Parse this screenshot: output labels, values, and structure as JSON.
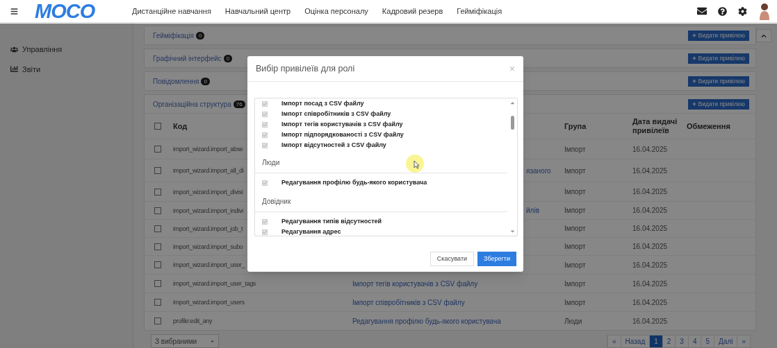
{
  "header": {
    "logo": "MOCO",
    "nav": [
      {
        "label": "Дистанційне навчання"
      },
      {
        "label": "Навчальний центр"
      },
      {
        "label": "Оцінка персоналу"
      },
      {
        "label": "Кадровий резерв"
      },
      {
        "label": "Гейміфікація"
      }
    ]
  },
  "sidebar": {
    "items": [
      {
        "label": "Управління",
        "kind": "users"
      },
      {
        "label": "Звіти",
        "kind": "chart"
      }
    ]
  },
  "sections": [
    {
      "title": "Гейміфікація",
      "count": "0",
      "button": "Видати привілею"
    },
    {
      "title": "Графічний інтерфейс",
      "count": "0",
      "button": "Видати привілею"
    },
    {
      "title": "Повідомлення",
      "count": "0",
      "button": "Видати привілею"
    },
    {
      "title": "Організаційна структура",
      "count": "76",
      "button": "Видати привілею"
    }
  ],
  "table": {
    "select_all": {
      "checked": false
    },
    "columns": [
      {
        "label": "Код"
      },
      {
        "label": "Група"
      },
      {
        "label": "Дата видачі привілеїв"
      },
      {
        "label": "Обмеження"
      }
    ],
    "rows": [
      {
        "checked": false,
        "code": "import_wizard.import_abse",
        "group": "Імпорт",
        "date": "16.04.2025"
      },
      {
        "checked": false,
        "code": "import_wizard.import_all_di",
        "description": "язаного",
        "partial": true,
        "group": "Імпорт",
        "date": "16.04.2025"
      },
      {
        "checked": false,
        "code": "import_wizard.import_divisi",
        "group": "Імпорт",
        "date": "16.04.2025"
      },
      {
        "checked": false,
        "code": "import_wizard.import_indivi",
        "description": "йлів",
        "partial": true,
        "group": "Імпорт",
        "date": "16.04.2025"
      },
      {
        "checked": false,
        "code": "import_wizard.import_job_t",
        "group": "Імпорт",
        "date": "16.04.2025"
      },
      {
        "checked": false,
        "code": "import_wizard.import_subo",
        "group": "Імпорт",
        "date": "16.04.2025"
      },
      {
        "checked": false,
        "code": "import_wizard.import_user_",
        "group": "Імпорт",
        "date": "16.04.2025"
      },
      {
        "checked": false,
        "code": "import_wizard.import_user_tags",
        "description": "Імпорт тегів користувачів з CSV файлу",
        "partial": false,
        "group": "Імпорт",
        "date": "16.04.2025"
      },
      {
        "checked": false,
        "code": "import_wizard.import_users",
        "description": "Імпорт співробітників з CSV файлу",
        "partial": false,
        "group": "Імпорт",
        "date": "16.04.2025"
      },
      {
        "checked": false,
        "code": "profile:edit_any",
        "description": "Редагування профілю будь-якого користувача",
        "partial": false,
        "group": "Люди",
        "date": "16.04.2025"
      }
    ]
  },
  "bulk_select": "З вибраними",
  "pagination": [
    {
      "label": "«",
      "selected": false
    },
    {
      "label": "Назад",
      "selected": false
    },
    {
      "label": "1",
      "selected": true
    },
    {
      "label": "2",
      "selected": false
    },
    {
      "label": "3",
      "selected": false
    },
    {
      "label": "4",
      "selected": false
    },
    {
      "label": "5",
      "selected": false
    },
    {
      "label": "Далі",
      "selected": false
    },
    {
      "label": "»",
      "selected": false
    }
  ],
  "modal": {
    "title": "Вибір привілеїв для ролі",
    "close": "×",
    "groups": [
      {
        "items": [
          {
            "label": "Імпорт посад з CSV файлу",
            "checked": true
          },
          {
            "label": "Імпорт співробітників з CSV файлу",
            "checked": true
          },
          {
            "label": "Імпорт тегів користувачів з CSV файлу",
            "checked": true
          },
          {
            "label": "Імпорт підпорядкованості з CSV файлу",
            "checked": true
          },
          {
            "label": "Імпорт відсутностей з CSV файлу",
            "checked": true
          }
        ]
      },
      {
        "title": "Люди",
        "items": [
          {
            "label": "Редагування профілю будь-якого користувача",
            "checked": true
          }
        ]
      },
      {
        "title": "Довідник",
        "items": [
          {
            "label": "Редагування типів відсутностей",
            "checked": true
          },
          {
            "label": "Редагування адрес",
            "checked": true
          }
        ]
      }
    ],
    "buttons": [
      {
        "label": "Скасувати",
        "kind": "secondary"
      },
      {
        "label": "Зберегти",
        "kind": "primary"
      }
    ]
  }
}
